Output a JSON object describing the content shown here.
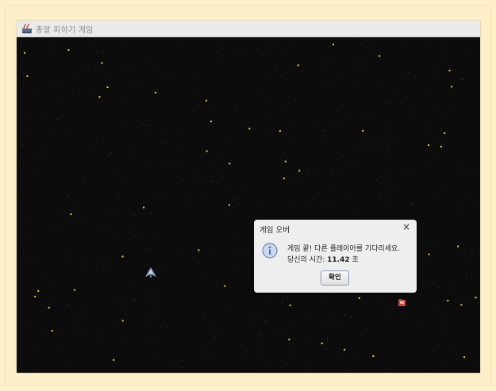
{
  "window": {
    "title": "총알 피하기 게임",
    "icon": "java-app-icon"
  },
  "game": {
    "background": "#0c0c0c",
    "star_color": "#f2c94c",
    "player_icon": "spaceship-icon",
    "enemy_icon": "enemy-block-icon"
  },
  "dialog": {
    "title": "게임 오버",
    "close_label": "×",
    "message_line1": "게임 끝! 다른 플레이어를 기다리세요.",
    "time_label": "당신의 시간: ",
    "time_value": "11.42",
    "time_unit": " 초",
    "ok_label": "확인",
    "icon": "info-icon"
  }
}
